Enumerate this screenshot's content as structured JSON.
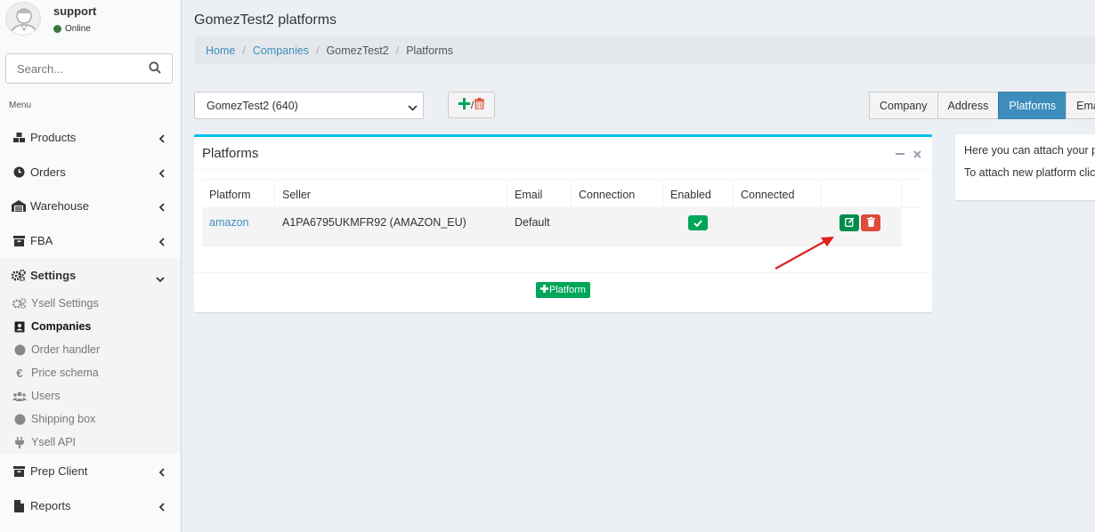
{
  "user": {
    "name": "support",
    "status": "Online"
  },
  "search": {
    "placeholder": "Search..."
  },
  "menu": {
    "header": "Menu",
    "items": [
      {
        "label": "Products"
      },
      {
        "label": "Orders"
      },
      {
        "label": "Warehouse"
      },
      {
        "label": "FBA"
      },
      {
        "label": "Settings"
      },
      {
        "label": "Prep Client"
      },
      {
        "label": "Reports"
      }
    ],
    "settings_sub": [
      {
        "label": "Ysell Settings"
      },
      {
        "label": "Companies"
      },
      {
        "label": "Order handler"
      },
      {
        "label": "Price schema"
      },
      {
        "label": "Users"
      },
      {
        "label": "Shipping box"
      },
      {
        "label": "Ysell API"
      }
    ]
  },
  "page": {
    "title": "GomezTest2 platforms"
  },
  "breadcrumb": [
    "Home",
    "Companies",
    "GomezTest2",
    "Platforms"
  ],
  "company_select": {
    "value": "GomezTest2 (640)"
  },
  "tabs": [
    "Company",
    "Address",
    "Platforms",
    "Email"
  ],
  "box": {
    "title": "Platforms",
    "columns": [
      "Platform",
      "Seller",
      "Email",
      "Connection",
      "Enabled",
      "Connected"
    ],
    "rows": [
      {
        "platform": "amazon",
        "seller": "A1PA6795UKMFR92 (AMAZON_EU)",
        "email": "Default",
        "connection": "",
        "enabled": true,
        "connected": ""
      }
    ],
    "add_button": "Platform"
  },
  "info": {
    "line1": "Here you can attach your pla",
    "line2": "To attach new platform click"
  },
  "colors": {
    "accent": "#3c8dbc",
    "success": "#00a65a",
    "danger": "#dd4b39",
    "box_top": "#00c0ef"
  }
}
